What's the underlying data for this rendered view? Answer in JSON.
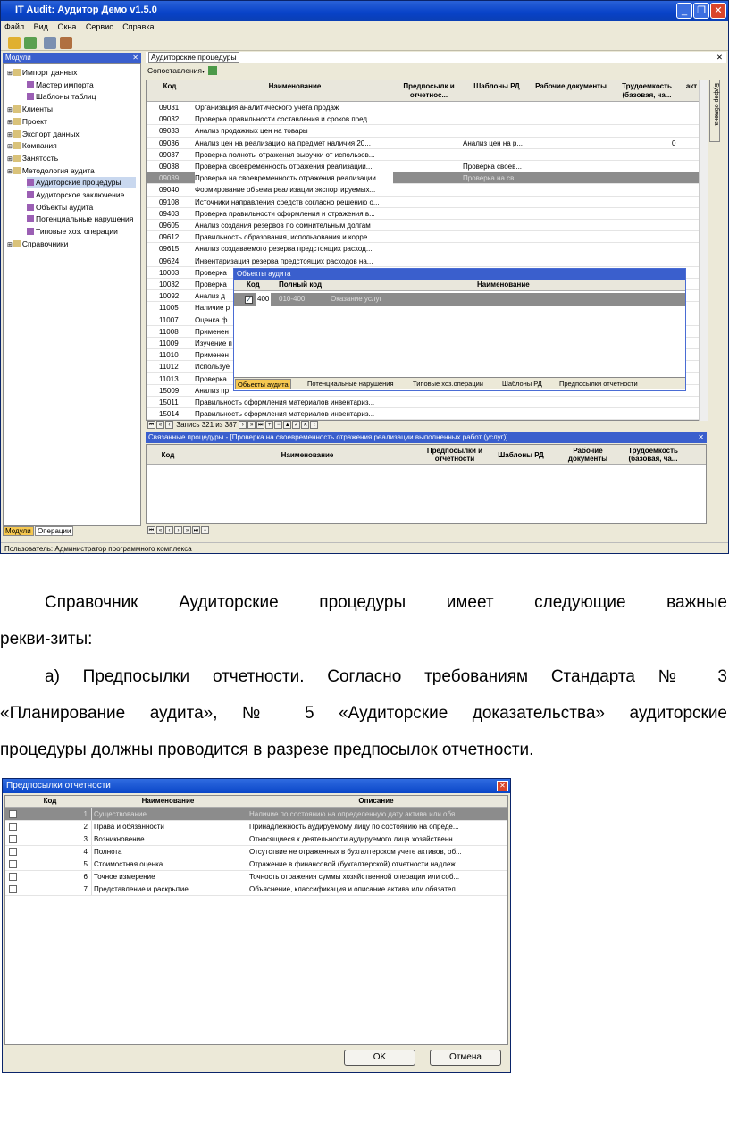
{
  "window": {
    "title": "IT Audit: Аудитор Демо v1.5.0"
  },
  "menu": [
    "Файл",
    "Вид",
    "Окна",
    "Сервис",
    "Справка"
  ],
  "modules_panel": {
    "title": "Модули",
    "tree": [
      {
        "label": "Импорт данных",
        "level": 0
      },
      {
        "label": "Мастер импорта",
        "level": 1
      },
      {
        "label": "Шаблоны таблиц",
        "level": 1
      },
      {
        "label": "Клиенты",
        "level": 0
      },
      {
        "label": "Проект",
        "level": 0
      },
      {
        "label": "Экспорт данных",
        "level": 0
      },
      {
        "label": "Компания",
        "level": 0
      },
      {
        "label": "Занятость",
        "level": 0
      },
      {
        "label": "Методология аудита",
        "level": 0
      },
      {
        "label": "Аудиторские процедуры",
        "level": 1,
        "selected": true
      },
      {
        "label": "Аудиторское заключение",
        "level": 1
      },
      {
        "label": "Объекты аудита",
        "level": 1
      },
      {
        "label": "Потенциальные нарушения",
        "level": 1
      },
      {
        "label": "Типовые хоз. операции",
        "level": 1
      },
      {
        "label": "Справочники",
        "level": 0
      }
    ],
    "tabs": [
      "Модули",
      "Операции"
    ]
  },
  "main_tab": "Аудиторские процедуры",
  "compare_button": "Сопоставления",
  "side_buffer": "Буфер обмена",
  "proc_grid": {
    "headers": [
      "Код",
      "Наименование",
      "Предпосылк и отчетнос...",
      "Шаблоны РД",
      "Рабочие документы",
      "Трудоемкость (базовая, ча...",
      "акт"
    ],
    "rows": [
      {
        "code": "09031",
        "name": "Организация аналитического учета продаж",
        "rd": "",
        "hours": ""
      },
      {
        "code": "09032",
        "name": "Проверка правильности составления и сроков пред...",
        "rd": "",
        "hours": ""
      },
      {
        "code": "09033",
        "name": "Анализ продажных цен на товары",
        "rd": "",
        "hours": ""
      },
      {
        "code": "09036",
        "name": "Анализ цен на реализацию на предмет наличия 20...",
        "rd": "Анализ цен на р...",
        "hours": "0"
      },
      {
        "code": "09037",
        "name": "Проверка полноты отражения выручки от использов...",
        "rd": "",
        "hours": ""
      },
      {
        "code": "09038",
        "name": "Проверка своевременность отражения реализации...",
        "rd": "Проверка своев...",
        "hours": ""
      },
      {
        "code": "09039",
        "name": "Проверка на своевременность отражения реализации",
        "rd": "Проверка на св...",
        "hours": "",
        "selected": true
      },
      {
        "code": "09040",
        "name": "Формирование объема реализации экспортируемых...",
        "rd": "",
        "hours": ""
      },
      {
        "code": "09108",
        "name": "Источники направления средств согласно решению о...",
        "rd": "",
        "hours": ""
      },
      {
        "code": "09403",
        "name": "Проверка правильности оформления и отражения в...",
        "rd": "",
        "hours": ""
      },
      {
        "code": "09605",
        "name": "Анализ создания резервов по сомнительным долгам",
        "rd": "",
        "hours": ""
      },
      {
        "code": "09612",
        "name": "Правильность образования, использования и корре...",
        "rd": "",
        "hours": ""
      },
      {
        "code": "09615",
        "name": "Анализ создаваемого резерва предстоящих расход...",
        "rd": "",
        "hours": ""
      },
      {
        "code": "09624",
        "name": "Инвентаризация резерва предстоящих расходов на...",
        "rd": "",
        "hours": ""
      },
      {
        "code": "10003",
        "name": "Проверка",
        "rd": "",
        "hours": ""
      },
      {
        "code": "10032",
        "name": "Проверка",
        "rd": "",
        "hours": ""
      },
      {
        "code": "10092",
        "name": "Анализ д",
        "rd": "",
        "hours": ""
      },
      {
        "code": "11005",
        "name": "Наличие р",
        "rd": "",
        "hours": ""
      },
      {
        "code": "11007",
        "name": "Оценка ф",
        "rd": "",
        "hours": ""
      },
      {
        "code": "11008",
        "name": "Применен",
        "rd": "",
        "hours": ""
      },
      {
        "code": "11009",
        "name": "Изучение п",
        "rd": "",
        "hours": ""
      },
      {
        "code": "11010",
        "name": "Применен",
        "rd": "",
        "hours": ""
      },
      {
        "code": "11012",
        "name": "Используе",
        "rd": "",
        "hours": ""
      },
      {
        "code": "11013",
        "name": "Проверка",
        "rd": "",
        "hours": ""
      },
      {
        "code": "15009",
        "name": "Анализ пр",
        "rd": "",
        "hours": ""
      },
      {
        "code": "15011",
        "name": "Правильность оформления материалов инвентариз...",
        "rd": "",
        "hours": ""
      },
      {
        "code": "15014",
        "name": "Правильность оформления материалов инвентариз...",
        "rd": "",
        "hours": ""
      }
    ],
    "record_nav": "Запись 321 из 387"
  },
  "popup": {
    "title": "Объекты аудита",
    "headers": [
      "Код",
      "Полный код",
      "Наименование"
    ],
    "row": {
      "code": "400",
      "full": "010-400",
      "name": "Оказание услуг"
    },
    "tabs": [
      "Объекты аудита",
      "Потенциальные нарушения",
      "Типовые хоз.операции",
      "Шаблоны РД",
      "Предпосылки отчетности"
    ]
  },
  "linked": {
    "title": "Связанные процедуры - [Проверка на своевременность отражения реализации выполненных работ (услуг)]",
    "headers": [
      "Код",
      "Наименование",
      "Предпосылки и отчетности",
      "Шаблоны РД",
      "Рабочие документы",
      "Трудоемкость (базовая, ча..."
    ]
  },
  "statusbar": "Пользователь: Администратор программного комплекса",
  "text": {
    "p1a": "Справочник Аудиторские процедуры имеет следующие важные",
    "p1b": "рекви-зиты:",
    "p2a": "а) Предпосылки отчетности. Согласно требованиям Стандарта № 3",
    "p2b": "«Планирование аудита», № 5 «Аудиторские доказательства» аудиторские",
    "p2c": "процедуры должны проводится в разрезе предпосылок отчетности."
  },
  "dialog": {
    "title": "Предпосылки отчетности",
    "headers": [
      "Код",
      "Наименование",
      "Описание"
    ],
    "rows": [
      {
        "code": "1",
        "name": "Существование",
        "desc": "Наличие по состоянию на определенную дату актива или обя...",
        "selected": true
      },
      {
        "code": "2",
        "name": "Права и обязанности",
        "desc": "Принадлежность аудируемому лицу по состоянию на опреде..."
      },
      {
        "code": "3",
        "name": "Возникновение",
        "desc": "Относящиеся к деятельности аудируемого лица хозяйственн..."
      },
      {
        "code": "4",
        "name": "Полнота",
        "desc": "Отсутствие не отраженных в бухгалтерском учете активов, об..."
      },
      {
        "code": "5",
        "name": "Стоимостная оценка",
        "desc": "Отражение в финансовой (бухгалтерской) отчетности надлеж..."
      },
      {
        "code": "6",
        "name": "Точное измерение",
        "desc": "Точность отражения суммы хозяйственной операции или соб..."
      },
      {
        "code": "7",
        "name": "Представление и раскрытие",
        "desc": "Объяснение, классификация и описание актива или обязател..."
      }
    ],
    "ok": "OK",
    "cancel": "Отмена"
  }
}
